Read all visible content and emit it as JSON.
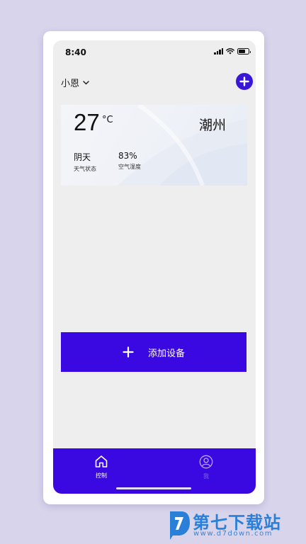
{
  "status_bar": {
    "time": "8:40"
  },
  "header": {
    "home_name": "小恩"
  },
  "weather": {
    "temperature": "27",
    "unit": "°C",
    "city": "潮州",
    "condition_value": "阴天",
    "condition_label": "天气状态",
    "humidity_value": "83%",
    "humidity_label": "空气湿度"
  },
  "add_device": {
    "label": "添加设备"
  },
  "tabbar": {
    "tabs": [
      {
        "label": "控制",
        "icon": "home-icon",
        "active": true
      },
      {
        "label": "我",
        "icon": "user-icon",
        "active": false
      }
    ]
  },
  "watermark": {
    "title": "第七下载站",
    "url": "www.d7down.com"
  },
  "colors": {
    "accent": "#3a08e0",
    "background": "#d8d4ec",
    "screen": "#eeeeee",
    "watermark": "#2a7fd8"
  }
}
